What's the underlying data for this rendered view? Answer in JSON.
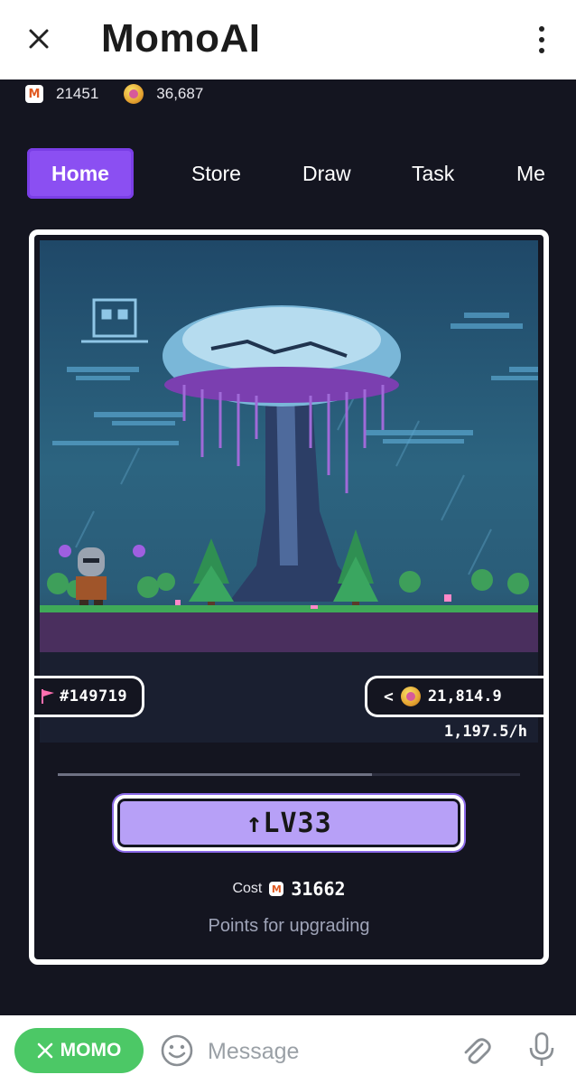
{
  "header": {
    "title": "MomoAI"
  },
  "balances": {
    "momo_points": "21451",
    "coins": "36,687"
  },
  "tabs": [
    {
      "label": "Home",
      "active": true
    },
    {
      "label": "Store",
      "active": false
    },
    {
      "label": "Draw",
      "active": false
    },
    {
      "label": "Task",
      "active": false
    },
    {
      "label": "Me",
      "active": false
    }
  ],
  "card": {
    "id_tag": "#149719",
    "earnings": "21,814.9",
    "rate": "1,197.5/h",
    "progress": 0.68,
    "upgrade_label": "↑LV33",
    "cost_label": "Cost",
    "cost_value": "31662",
    "note": "Points for upgrading"
  },
  "composer": {
    "chip_label": "MOMO",
    "placeholder": "Message"
  },
  "colors": {
    "accent": "#8b4ff2",
    "chip": "#4cc866",
    "upgrade": "#b7a0f7"
  }
}
